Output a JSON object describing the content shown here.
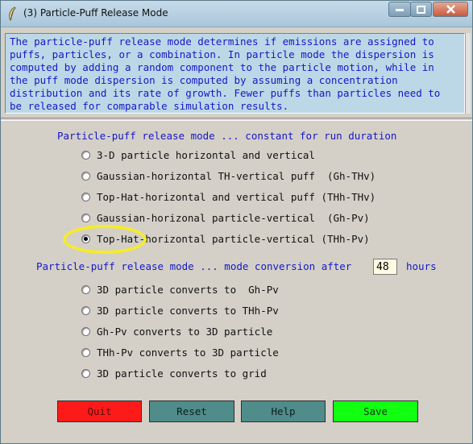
{
  "window": {
    "title": "(3) Particle-Puff Release Mode",
    "controls": {
      "minimize": "minimize",
      "maximize": "maximize",
      "close": "close"
    }
  },
  "description": "The particle-puff release mode determines if emissions are assigned to\npuffs, particles, or a combination. In particle mode the dispersion is\ncomputed by adding a random component to the particle motion, while in\nthe puff mode dispersion is computed by assuming a concentration\ndistribution and its rate of growth. Fewer puffs than particles need to\nbe released for comparable simulation results.",
  "section1": {
    "heading": "Particle-puff release mode ... constant for run duration",
    "options": [
      {
        "label": "3-D particle horizontal and vertical",
        "selected": false
      },
      {
        "label": "Gaussian-horizontal TH-vertical puff  (Gh-THv)",
        "selected": false
      },
      {
        "label": "Top-Hat-horizontal and vertical puff (THh-THv)",
        "selected": false
      },
      {
        "label": "Gaussian-horizonal particle-vertical  (Gh-Pv)",
        "selected": false
      },
      {
        "label": "Top-Hat-horizontal particle-vertical (THh-Pv)",
        "selected": true
      }
    ]
  },
  "section2": {
    "heading": "Particle-puff release mode ... mode conversion after",
    "hours_value": "48",
    "hours_label": "hours",
    "options": [
      {
        "label": "3D particle converts to  Gh-Pv",
        "selected": false
      },
      {
        "label": "3D particle converts to THh-Pv",
        "selected": false
      },
      {
        "label": "Gh-Pv converts to 3D particle",
        "selected": false
      },
      {
        "label": "THh-Pv converts to 3D particle",
        "selected": false
      },
      {
        "label": "3D particle converts to grid",
        "selected": false
      }
    ]
  },
  "buttons": {
    "quit": "Quit",
    "reset": "Reset",
    "help": "Help",
    "save": "Save"
  },
  "colors": {
    "text_blue": "#1616c8",
    "quit": "#ff1a1a",
    "reset": "#4f8c8a",
    "help": "#4f8c8a",
    "save": "#11ff11",
    "highlight": "#f5ec2a"
  }
}
